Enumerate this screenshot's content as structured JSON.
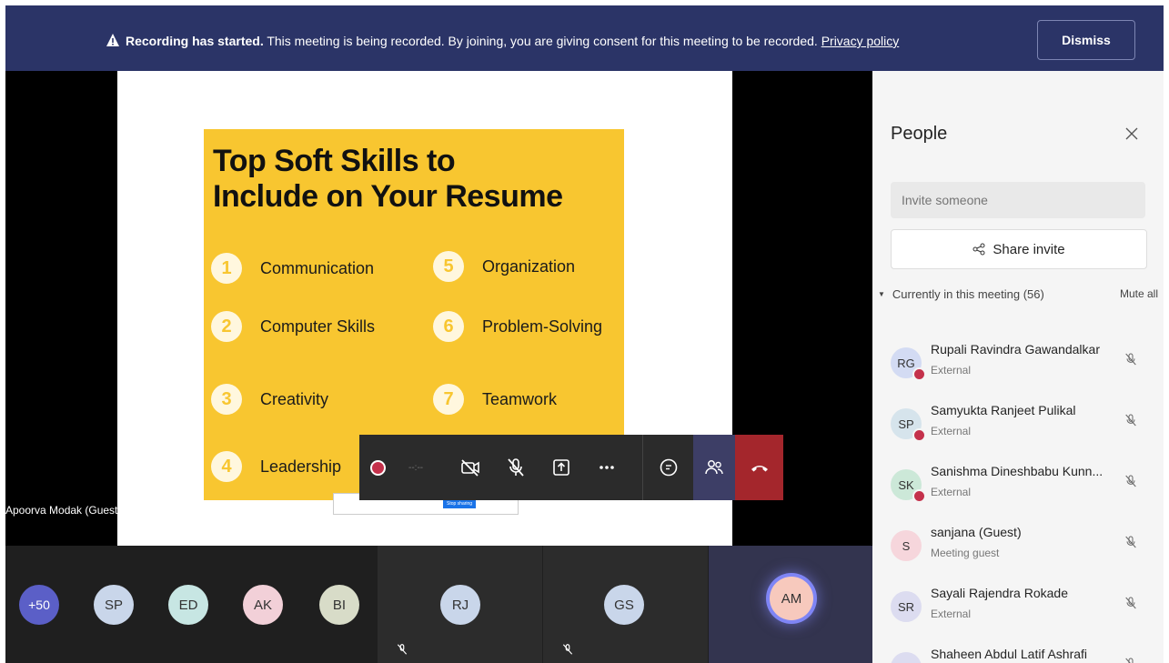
{
  "banner": {
    "title": "Recording has started.",
    "message": " This meeting is being recorded. By joining, you are giving consent for this meeting to be recorded. ",
    "link": "Privacy policy",
    "dismiss": "Dismiss"
  },
  "slide": {
    "title_line1": "Top Soft Skills to",
    "title_line2": "Include on Your Resume",
    "skills": [
      {
        "num": "1",
        "label": "Communication"
      },
      {
        "num": "2",
        "label": "Computer Skills"
      },
      {
        "num": "3",
        "label": "Creativity"
      },
      {
        "num": "4",
        "label": "Leadership"
      },
      {
        "num": "5",
        "label": "Organization"
      },
      {
        "num": "6",
        "label": "Problem-Solving"
      },
      {
        "num": "7",
        "label": "Teamwork"
      }
    ],
    "share_notice": "Stop sharing"
  },
  "presenter": {
    "name": "Apoorva Modak (Guest)"
  },
  "controls": {
    "timer": "--:--"
  },
  "bottom_row": {
    "overflow": "+50",
    "participants": [
      {
        "initials": "SP",
        "color": "#c9d6ea"
      },
      {
        "initials": "ED",
        "color": "#c7e6e3"
      },
      {
        "initials": "AK",
        "color": "#f2d0d8"
      },
      {
        "initials": "BI",
        "color": "#d8dcc8"
      }
    ],
    "tiles": [
      {
        "initials": "RJ",
        "color": "#c9d6ea"
      },
      {
        "initials": "GS",
        "color": "#c9d6ea"
      },
      {
        "initials": "AM",
        "color": "#f7c9bd"
      }
    ]
  },
  "panel": {
    "title": "People",
    "invite_placeholder": "Invite someone",
    "share_label": "Share invite",
    "section": "Currently in this meeting (56)",
    "mute_all": "Mute all",
    "people": [
      {
        "initials": "RG",
        "name": "Rupali Ravindra Gawandalkar",
        "sub": "External",
        "color": "#d3dbf3"
      },
      {
        "initials": "SP",
        "name": "Samyukta Ranjeet Pulikal",
        "sub": "External",
        "color": "#d6e4ec"
      },
      {
        "initials": "SK",
        "name": "Sanishma Dineshbabu Kunn...",
        "sub": "External",
        "color": "#cce8d8"
      },
      {
        "initials": "S",
        "name": "sanjana (Guest)",
        "sub": "Meeting guest",
        "color": "#f6d6dc"
      },
      {
        "initials": "SR",
        "name": "Sayali Rajendra Rokade",
        "sub": "External",
        "color": "#dcdcf0"
      },
      {
        "initials": "SA",
        "name": "Shaheen Abdul Latif Ashrafi",
        "sub": "",
        "color": "#dcdcf0"
      }
    ]
  },
  "colors": {
    "banner": "#2b3467",
    "slide": "#f8c630",
    "hangup": "#a4262c",
    "record": "#c4314b"
  }
}
